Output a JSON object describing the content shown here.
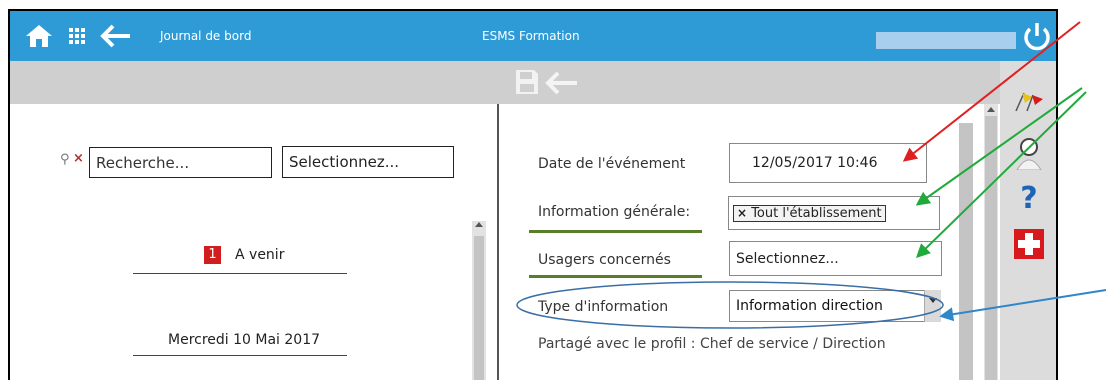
{
  "header": {
    "nav_label": "Journal de bord",
    "app_title": "ESMS Formation"
  },
  "left": {
    "search_placeholder": "Recherche...",
    "select_placeholder": "Selectionnez...",
    "upcoming_badge": "1",
    "upcoming_label": "A venir",
    "date_label": "Mercredi 10 Mai 2017"
  },
  "form": {
    "event_date_label": "Date de l'événement",
    "event_date_value": "12/05/2017 10:46",
    "general_info_label": "Information générale:",
    "general_info_tag": "Tout l'établissement",
    "users_label": "Usagers concernés",
    "users_value": "Selectionnez...",
    "info_type_label": "Type d'information",
    "info_type_value": "Information direction",
    "shared_text": "Partagé avec le profil : Chef de service / Direction"
  },
  "colors": {
    "header": "#2f9bd6",
    "underline": "#5a7d2a",
    "arrow_red": "#e02020",
    "arrow_green": "#1faa3a",
    "arrow_blue": "#2f86c9"
  }
}
